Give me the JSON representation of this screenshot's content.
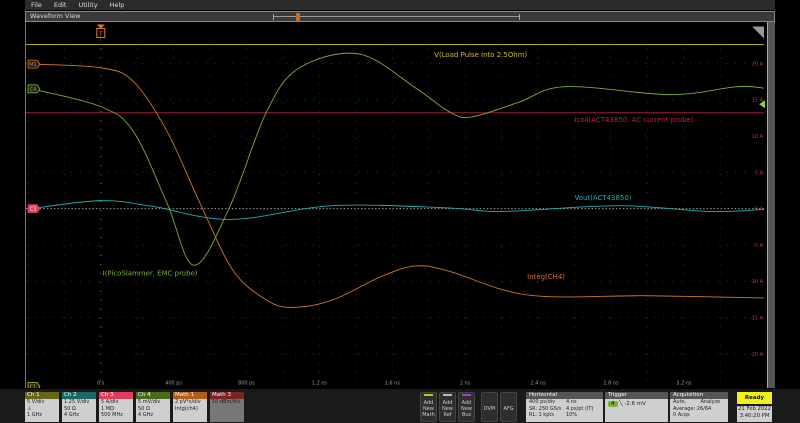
{
  "menu": [
    "File",
    "Edit",
    "Utility",
    "Help"
  ],
  "view_title": "Waveform View",
  "trigger_marker": "T",
  "colors": {
    "ch1": "#c8c020",
    "ch2": "#20b0b0",
    "ch3": "#e03c5c",
    "ch4": "#7ab030",
    "math1": "#d07820",
    "math3": "#8a2a2a",
    "icoil": "#c02040"
  },
  "chart_data": {
    "type": "line",
    "x_unit": "ns",
    "y_unit": "A",
    "xlim": [
      -0.41,
      3.64
    ],
    "ylim": [
      -24.5,
      23.3
    ],
    "x_ticks": [
      {
        "v": 0,
        "label": "0 s"
      },
      {
        "v": 0.4,
        "label": "400 ps"
      },
      {
        "v": 0.8,
        "label": "800 ps"
      },
      {
        "v": 1.2,
        "label": "1.2 ns"
      },
      {
        "v": 1.6,
        "label": "1.6 ns"
      },
      {
        "v": 2.0,
        "label": "2 ns"
      },
      {
        "v": 2.4,
        "label": "2.4 ns"
      },
      {
        "v": 2.8,
        "label": "2.8 ns"
      },
      {
        "v": 3.2,
        "label": "3.2 ns"
      }
    ],
    "y_ticks": [
      {
        "v": 20,
        "label": "20 A"
      },
      {
        "v": 15,
        "label": "15 A"
      },
      {
        "v": 10,
        "label": "10 A"
      },
      {
        "v": 5,
        "label": "5 A"
      },
      {
        "v": 0,
        "label": "0 A"
      },
      {
        "v": -5,
        "label": "-5 A"
      },
      {
        "v": -10,
        "label": "-10 A"
      },
      {
        "v": -15,
        "label": "-15 A"
      },
      {
        "v": -20,
        "label": "-20 A"
      }
    ],
    "grid": true,
    "series": [
      {
        "name": "V(Load Pulse into 2.5Ohm)",
        "key": "ch1",
        "x": [
          -0.41,
          3.64
        ],
        "y": [
          22.6,
          22.6
        ]
      },
      {
        "name": "Icoil(ACT43850, AC current probe)",
        "key": "icoil",
        "x": [
          -0.41,
          3.64
        ],
        "y": [
          13.2,
          13.2
        ]
      },
      {
        "name": "I(PicoSlammer, EMC probe)",
        "key": "ch4",
        "x": [
          -0.38,
          0,
          0.18,
          0.365,
          0.513,
          0.709,
          0.911,
          1.091,
          1.418,
          1.729,
          1.909,
          2.029,
          2.29,
          2.548,
          3.126,
          3.491,
          3.639
        ],
        "y": [
          16.5,
          14.05,
          10.6,
          0.7,
          -7.8,
          0.3,
          13.4,
          19.4,
          21.3,
          16.6,
          13.4,
          12.6,
          14.6,
          16.8,
          15.7,
          16.8,
          16.6
        ]
      },
      {
        "name": "Integ(CH4)",
        "key": "math1",
        "x": [
          -0.38,
          0,
          0.18,
          0.365,
          0.546,
          0.726,
          0.911,
          1.053,
          1.271,
          1.544,
          1.729,
          1.909,
          2.346,
          3.0,
          3.639
        ],
        "y": [
          19.9,
          19.4,
          17.5,
          10.6,
          0.7,
          -8.5,
          -12.6,
          -13.6,
          -12.6,
          -9.3,
          -7.9,
          -8.6,
          -11.9,
          -12.0,
          -12.3
        ]
      },
      {
        "name": "Vout(ACT43850)",
        "key": "ch2",
        "x": [
          -0.38,
          0,
          0.289,
          0.709,
          1.271,
          1.909,
          2.199,
          2.837,
          3.344,
          3.639
        ],
        "y": [
          0,
          1.1,
          0.3,
          -1.5,
          0.4,
          0.1,
          -0.4,
          0.4,
          -0.4,
          -0.1
        ]
      }
    ],
    "labels": [
      {
        "text": "V(Load Pulse into 2.5Ohm)",
        "key": "ch1",
        "x": 1.83,
        "y": 20.9
      },
      {
        "text": "Icoil(ACT43850, AC current probe)",
        "key": "icoil",
        "x": 2.6,
        "y": 11.9
      },
      {
        "text": "Vout(ACT43850)",
        "key": "ch2",
        "x": 2.6,
        "y": 1.2
      },
      {
        "text": "I(PicoSlammer, EMC probe)",
        "key": "ch4",
        "x": 0.01,
        "y": -9.2
      },
      {
        "text": "Integ(CH4)",
        "key": "math1",
        "x": 2.34,
        "y": -9.7
      }
    ],
    "markers": [
      {
        "text": "M1",
        "key": "math1",
        "y": 19.9
      },
      {
        "text": "C4",
        "key": "ch4",
        "y": 16.5
      },
      {
        "text": "C3",
        "key": "ch3",
        "y": 0
      },
      {
        "text": "C1",
        "key": "ch1",
        "y": -24.5
      }
    ]
  },
  "channels": [
    {
      "name": "Ch 1",
      "lines": [
        "5 V/div",
        "⏚",
        "1 GHz"
      ],
      "color": "#6a6418"
    },
    {
      "name": "Ch 2",
      "lines": [
        "1.25 V/div",
        "50 Ω",
        "4 GHz"
      ],
      "color": "#1a6a6a"
    },
    {
      "name": "Ch 3",
      "lines": [
        "5 A/div",
        "1 MΩ",
        "500 MHz"
      ],
      "color": "#e03c5c"
    },
    {
      "name": "Ch 4",
      "lines": [
        "5 mV/div",
        "50 Ω",
        "4 GHz"
      ],
      "color": "#4a6a1e"
    },
    {
      "name": "Math 1",
      "lines": [
        "2 pV*s/div",
        "Intg(ch4)",
        ""
      ],
      "color": "#b05e14"
    },
    {
      "name": "Math 3",
      "lines": [
        "10 dBm/div",
        "",
        ""
      ],
      "color": "#7a2424"
    }
  ],
  "buttons": {
    "add_math": "Add New Math",
    "add_ref": "Add New Ref",
    "add_bus": "Add New Bus",
    "dvm": "DVM",
    "afg": "AFG"
  },
  "horizontal": {
    "title": "Horizontal",
    "rows": [
      "400 ps/div",
      "4 ns",
      "SR: 250 GS/s",
      "4 ps/pt (IT)",
      "RL: 1 kpts",
      "10%"
    ]
  },
  "trigger": {
    "title": "Trigger",
    "source": "4",
    "level": "-2.6 mV"
  },
  "acquisition": {
    "title": "Acquisition",
    "rows": [
      "Auto,",
      "Analyze",
      "Average: 26/64",
      "",
      "0 Acqs",
      ""
    ]
  },
  "status": {
    "label": "Ready",
    "date": "21 Feb 2022",
    "time": "3:40:20 PM"
  }
}
